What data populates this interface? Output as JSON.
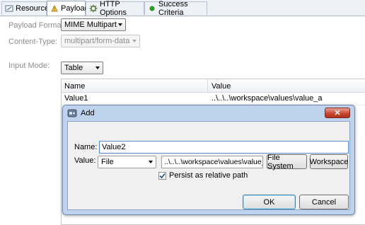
{
  "tabs": [
    {
      "label": "Resource",
      "icon": "resource-icon"
    },
    {
      "label": "Payload",
      "icon": "payload-icon"
    },
    {
      "label": "HTTP Options",
      "icon": "http-options-icon"
    },
    {
      "label": "Success Criteria",
      "icon": "success-criteria-icon"
    }
  ],
  "active_tab": "Payload",
  "form": {
    "payload_format_label": "Payload Format:",
    "payload_format_value": "MIME Multipart",
    "content_type_label": "Content-Type:",
    "content_type_value": "multipart/form-data",
    "input_mode_label": "Input Mode:",
    "input_mode_value": "Table"
  },
  "table": {
    "columns": [
      "Name",
      "Value"
    ],
    "rows": [
      {
        "name": "Value1",
        "value": "..\\..\\..\\workspace\\values\\value_a"
      }
    ]
  },
  "dialog": {
    "title": "Add",
    "close_glyph": "✕",
    "name_label": "Name:",
    "name_value": "Value2",
    "value_label": "Value:",
    "value_type": "File",
    "value_path": "..\\..\\..\\workspace\\values\\value_b",
    "file_system_button": "File System",
    "workspace_button": "Workspace",
    "persist_checked": true,
    "persist_label": "Persist as relative path",
    "ok_button": "OK",
    "cancel_button": "Cancel"
  },
  "colors": {
    "dialog_frame": "#bdd3ee",
    "close_button": "#c7442e",
    "success_dot": "#2e9a2e"
  }
}
